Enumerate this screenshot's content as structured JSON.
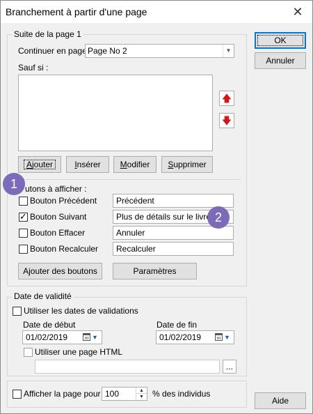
{
  "window": {
    "title": "Branchement à partir d'une page"
  },
  "buttons": {
    "ok": "OK",
    "cancel": "Annuler",
    "help": "Aide"
  },
  "group_page": {
    "legend": "Suite de la page 1",
    "continue_label": "Continuer en page",
    "continue_value": "Page No 2",
    "except_label": "Sauf si :",
    "conditions": [],
    "actions": {
      "add": {
        "pre": "",
        "u": "A",
        "post": "jouter"
      },
      "insert": {
        "pre": "",
        "u": "I",
        "post": "nsérer"
      },
      "modify": {
        "pre": "",
        "u": "M",
        "post": "odifier"
      },
      "delete": {
        "pre": "",
        "u": "S",
        "post": "upprimer"
      }
    },
    "buttons_section_label": "utons à afficher :",
    "nav_buttons": [
      {
        "name": "Bouton Précédent",
        "checked": false,
        "text": "Précédent"
      },
      {
        "name": "Bouton Suivant",
        "checked": true,
        "text": "Plus de détails sur le livre"
      },
      {
        "name": "Bouton Effacer",
        "checked": false,
        "text": "Annuler"
      },
      {
        "name": "Bouton Recalculer",
        "checked": false,
        "text": "Recalculer"
      }
    ],
    "add_buttons_label": "Ajouter des boutons",
    "params_label": "Paramètres"
  },
  "group_validity": {
    "legend": "Date de validité",
    "use_dates_label": "Utiliser les dates de validations",
    "use_dates_checked": false,
    "start_label": "Date de début",
    "start_value": "01/02/2019",
    "end_label": "Date de fin",
    "end_value": "01/02/2019",
    "use_html_label": "Utiliser une page HTML",
    "use_html_checked": false,
    "html_path": "",
    "browse_label": "..."
  },
  "display_page": {
    "label": "Afficher la page pour",
    "value": "100",
    "suffix": "% des individus",
    "checked": false
  },
  "badges": [
    "1",
    "2"
  ],
  "icons": {
    "close": "close-icon",
    "up": "arrow-up-icon",
    "down": "arrow-down-icon",
    "calendar": "calendar-icon",
    "dropdown": "chevron-down-icon"
  }
}
